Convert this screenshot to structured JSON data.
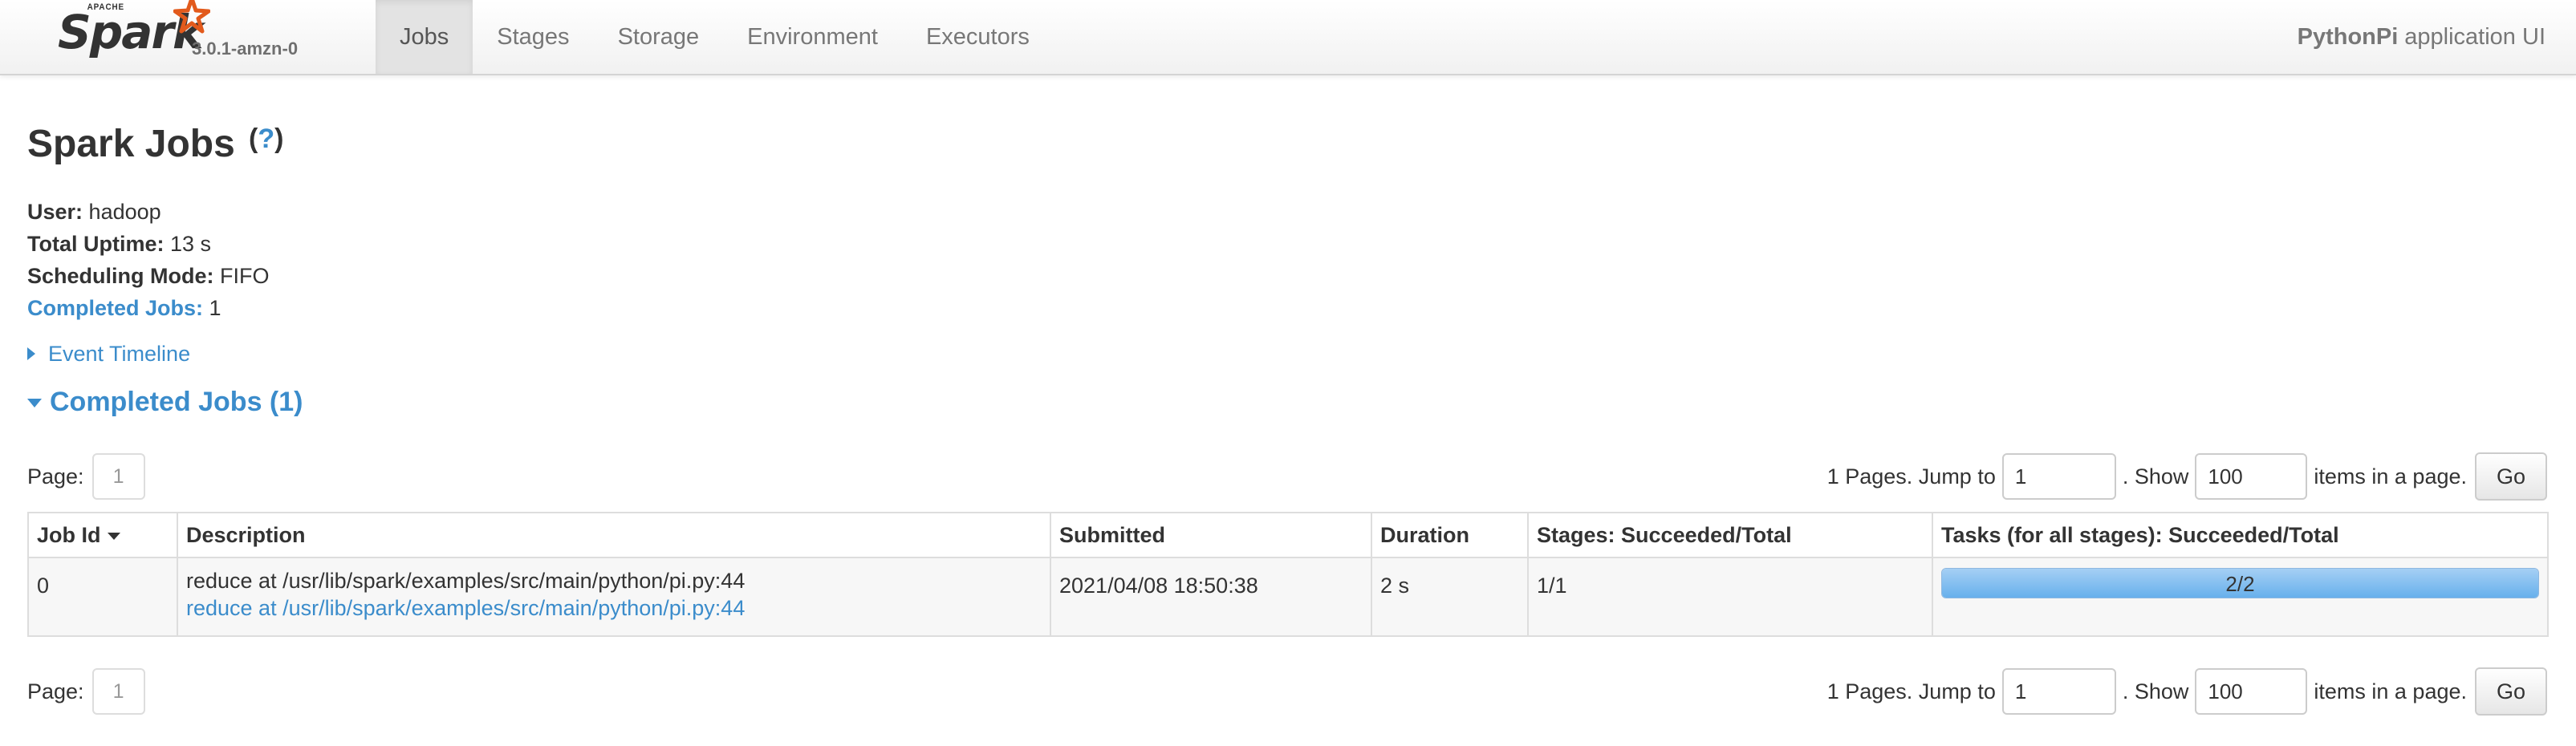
{
  "brand": {
    "apache_label": "APACHE",
    "logo_text": "Spark",
    "version": "3.0.1-amzn-0"
  },
  "nav": {
    "tabs": [
      {
        "label": "Jobs",
        "active": true
      },
      {
        "label": "Stages",
        "active": false
      },
      {
        "label": "Storage",
        "active": false
      },
      {
        "label": "Environment",
        "active": false
      },
      {
        "label": "Executors",
        "active": false
      }
    ],
    "app_name": "PythonPi",
    "app_suffix": "application UI"
  },
  "page": {
    "title": "Spark Jobs",
    "help": "?"
  },
  "summary": {
    "user_label": "User:",
    "user_value": "hadoop",
    "uptime_label": "Total Uptime:",
    "uptime_value": "13 s",
    "mode_label": "Scheduling Mode:",
    "mode_value": "FIFO",
    "completed_label": "Completed Jobs:",
    "completed_value": "1"
  },
  "sections": {
    "event_timeline": "Event Timeline",
    "completed_jobs": "Completed Jobs (1)"
  },
  "pagination": {
    "page_label": "Page:",
    "current_page": "1",
    "pages_text": "1 Pages. Jump to",
    "jump_value": "1",
    "show_text": ". Show",
    "show_value": "100",
    "items_text": "items in a page.",
    "go_label": "Go"
  },
  "table": {
    "columns": [
      "Job Id",
      "Description",
      "Submitted",
      "Duration",
      "Stages: Succeeded/Total",
      "Tasks (for all stages): Succeeded/Total"
    ],
    "sort_column": "Job Id",
    "sort_direction": "descending",
    "rows": [
      {
        "job_id": "0",
        "description": "reduce at /usr/lib/spark/examples/src/main/python/pi.py:44",
        "description_link": "reduce at /usr/lib/spark/examples/src/main/python/pi.py:44",
        "submitted": "2021/04/08 18:50:38",
        "duration": "2 s",
        "stages": "1/1",
        "tasks_label": "2/2",
        "tasks_succeeded": 2,
        "tasks_total": 2
      }
    ]
  },
  "colors": {
    "link": "#3b8ccb",
    "progress_fill": "#67b0ec",
    "spark_orange": "#e25a1c"
  }
}
